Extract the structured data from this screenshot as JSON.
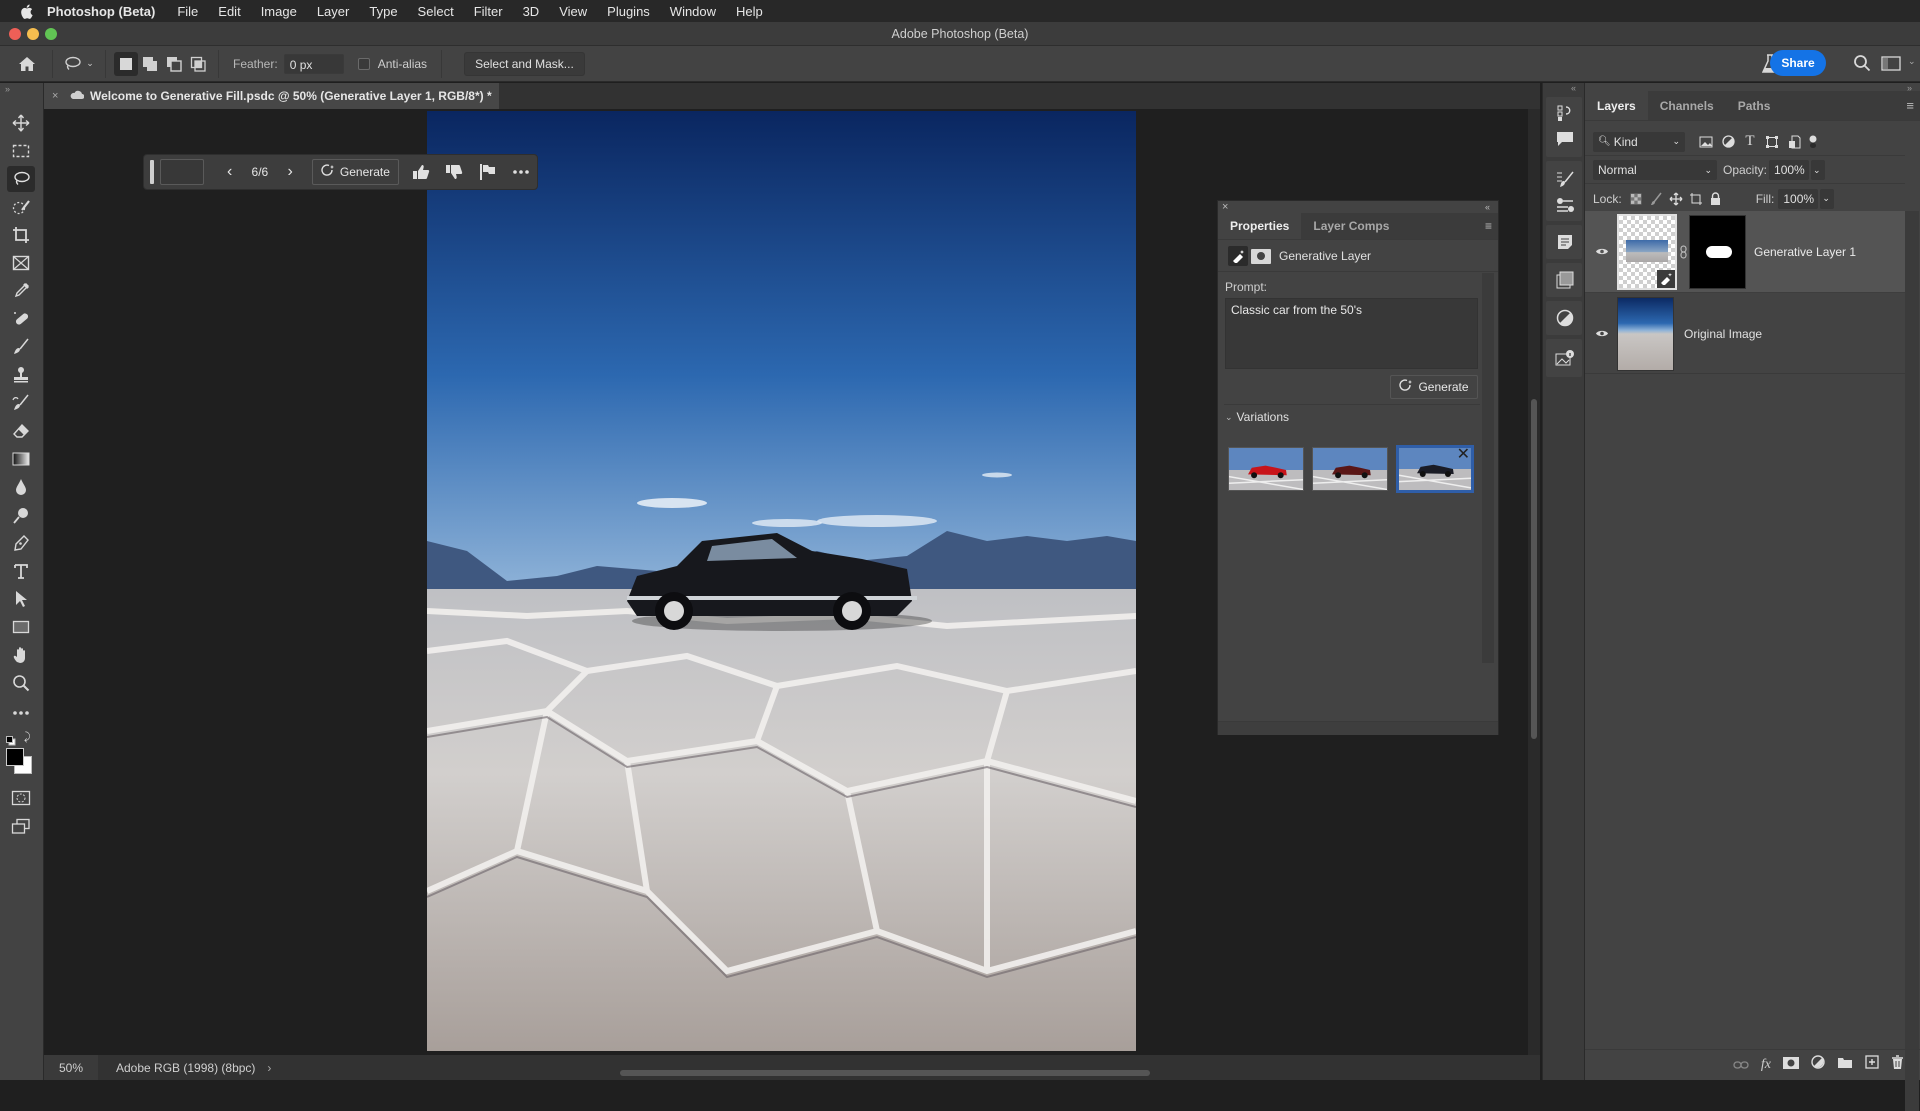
{
  "menubar": {
    "app_name": "Photoshop (Beta)",
    "items": [
      "File",
      "Edit",
      "Image",
      "Layer",
      "Type",
      "Select",
      "Filter",
      "3D",
      "View",
      "Plugins",
      "Window",
      "Help"
    ]
  },
  "window": {
    "title": "Adobe Photoshop (Beta)"
  },
  "options_bar": {
    "feather_label": "Feather:",
    "feather_value": "0 px",
    "antialias_label": "Anti-alias",
    "antialias_checked": false,
    "select_mask_label": "Select and Mask...",
    "share_label": "Share"
  },
  "document": {
    "tab_title": "Welcome to Generative Fill.psdc @ 50% (Generative Layer 1, RGB/8*) *",
    "zoom": "50%",
    "color_profile": "Adobe RGB (1998) (8bpc)"
  },
  "taskbar": {
    "counter": "6/6",
    "generate_label": "Generate"
  },
  "tools": [
    "move",
    "rectangular-marquee",
    "lasso",
    "object-selection",
    "crop",
    "frame",
    "eyedropper",
    "spot-healing",
    "brush",
    "clone-stamp",
    "history-brush",
    "eraser",
    "gradient",
    "blur",
    "dodge",
    "pen",
    "type",
    "path-selection",
    "rectangle",
    "hand",
    "zoom",
    "more",
    "default-colors",
    "swap-colors",
    "foreground",
    "background",
    "quick-mask",
    "screen-mode"
  ],
  "active_tool": "lasso",
  "properties": {
    "tabs": [
      "Properties",
      "Layer Comps"
    ],
    "active_tab": "Properties",
    "layer_type": "Generative Layer",
    "prompt_label": "Prompt:",
    "prompt_value": "Classic car from the 50's",
    "generate_label": "Generate",
    "variations_label": "Variations",
    "variations": [
      {
        "car_color": "#c8141a",
        "selected": false
      },
      {
        "car_color": "#5a1616",
        "selected": false
      },
      {
        "car_color": "#1a1c26",
        "selected": true
      }
    ]
  },
  "layers_panel": {
    "tabs": [
      "Layers",
      "Channels",
      "Paths"
    ],
    "active_tab": "Layers",
    "filter_kind": "Kind",
    "blend_mode": "Normal",
    "opacity_label": "Opacity:",
    "opacity_value": "100%",
    "lock_label": "Lock:",
    "fill_label": "Fill:",
    "fill_value": "100%",
    "layers": [
      {
        "name": "Generative Layer 1",
        "visible": true,
        "selected": true
      },
      {
        "name": "Original Image",
        "visible": true,
        "selected": false
      }
    ]
  },
  "colors": {
    "accent": "#1473e6",
    "panel_bg": "#434343",
    "canvas_bg": "#1f1f1f"
  }
}
